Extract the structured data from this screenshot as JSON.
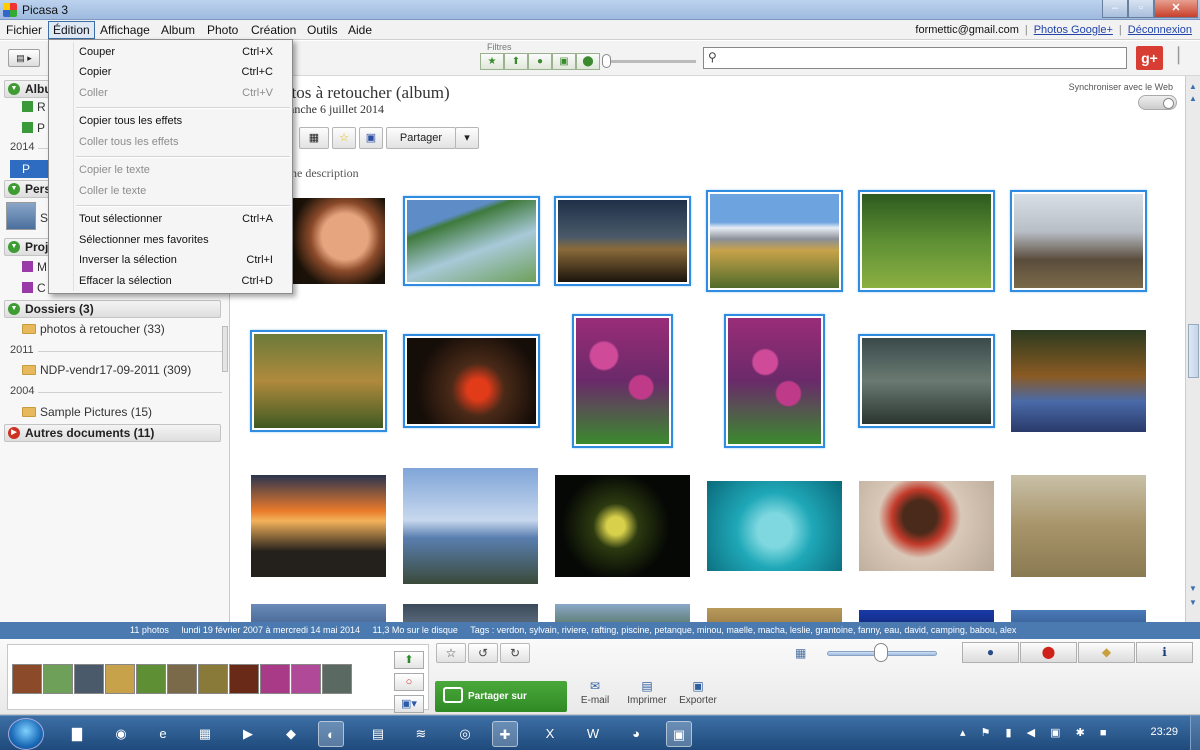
{
  "window": {
    "title": "Picasa 3"
  },
  "menubar": {
    "items": [
      "Fichier",
      "Édition",
      "Affichage",
      "Album",
      "Photo",
      "Création",
      "Outils",
      "Aide"
    ],
    "account_email": "formettic@gmail.com",
    "photos_link": "Photos Google+",
    "logout_link": "Déconnexion"
  },
  "toolbar": {
    "filters_label": "Filtres",
    "search_placeholder": ""
  },
  "edit_menu": {
    "items": [
      {
        "label": "Couper",
        "shortcut": "Ctrl+X",
        "enabled": true
      },
      {
        "label": "Copier",
        "shortcut": "Ctrl+C",
        "enabled": true
      },
      {
        "label": "Coller",
        "shortcut": "Ctrl+V",
        "enabled": false
      },
      {
        "label": "Copier tous les effets",
        "shortcut": "",
        "enabled": true
      },
      {
        "label": "Coller tous les effets",
        "shortcut": "",
        "enabled": false
      },
      {
        "label": "Copier le texte",
        "shortcut": "",
        "enabled": false
      },
      {
        "label": "Coller le texte",
        "shortcut": "",
        "enabled": false
      },
      {
        "label": "Tout sélectionner",
        "shortcut": "Ctrl+A",
        "enabled": true
      },
      {
        "label": "Sélectionner mes favorites",
        "shortcut": "",
        "enabled": true
      },
      {
        "label": "Inverser la sélection",
        "shortcut": "Ctrl+I",
        "enabled": true
      },
      {
        "label": "Effacer la sélection",
        "shortcut": "Ctrl+D",
        "enabled": true
      }
    ]
  },
  "sidebar": {
    "albums_label": "Albu",
    "album_rows": [
      "R",
      "P"
    ],
    "year_2014": "2014",
    "selected_row": "P",
    "people_label": "Pers",
    "person_row": "S",
    "projects_label": "Proj",
    "project_rows": [
      "M",
      "C"
    ],
    "folders_header": "Dossiers (3)",
    "folders": [
      {
        "label": "photos à retoucher (33)"
      },
      {
        "year": "2011"
      },
      {
        "label": "NDP-vendr17-09-2011 (309)"
      },
      {
        "year": "2004"
      },
      {
        "label": "Sample Pictures (15)"
      }
    ],
    "other_header": "Autres documents (11)"
  },
  "album": {
    "title": "otos à retoucher (album)",
    "date": "nanche 6 juillet 2014",
    "description": "une description",
    "sync_label": "Synchroniser avec le Web",
    "share_label": "Partager"
  },
  "statusbar": {
    "count": "11 photos",
    "dates": "lundi 19 février 2007 à mercredi 14 mai 2014",
    "size": "11,3 Mo sur le disque",
    "tags": "Tags : verdon, sylvain, riviere, rafting, piscine, petanque, minou, maelle, macha, leslie, grantoine, fanny, eau, david, camping, babou, alex"
  },
  "tray": {
    "share_button": "Partager sur Google+",
    "actions": [
      "E-mail",
      "Imprimer",
      "Exporter"
    ]
  },
  "taskbar": {
    "clock": "23:29"
  },
  "colors": {
    "selection": "#2f8ce0",
    "statusbar": "#4a7ab0",
    "share_green": "#3a9a2e"
  }
}
